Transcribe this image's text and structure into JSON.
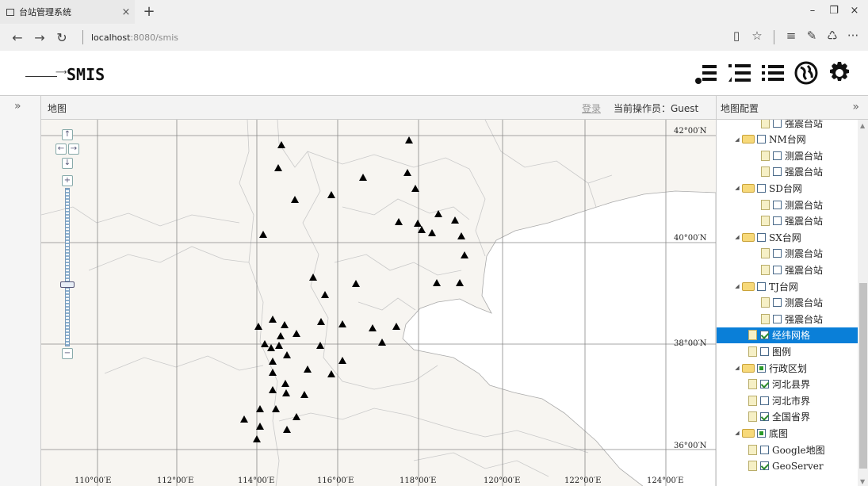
{
  "browser": {
    "tab_title": "台站管理系统",
    "tab_close": "×",
    "new_tab": "+",
    "minimize": "–",
    "restore": "❐",
    "close": "×",
    "back": "←",
    "forward": "→",
    "refresh": "↻",
    "url_host": "localhost",
    "url_path": ":8080/smis",
    "reading_view": "▯",
    "favorite": "☆",
    "hub": "≡",
    "notes": "✎",
    "share": "♺",
    "more": "···"
  },
  "app": {
    "logo_text": "SMIS",
    "toolbar_icons": [
      "layer-list-icon",
      "ordered-list-icon",
      "list-icon",
      "globe-icon",
      "gear-icon"
    ]
  },
  "left_panel": {
    "expand": "»"
  },
  "map_panel": {
    "title": "地图",
    "login_link": "登录",
    "operator_label": "当前操作员：Guest"
  },
  "map": {
    "lat_labels": [
      "42°00′N",
      "40°00′N",
      "38°00′N",
      "36°00′N"
    ],
    "lon_labels": [
      "110°00′E",
      "112°00′E",
      "114°00′E",
      "116°00′E",
      "118°00′E",
      "120°00′E",
      "122°00′E",
      "124°00′E"
    ],
    "zoom_controls": {
      "pan_up": "↑",
      "pan_left": "←",
      "pan_right": "→",
      "pan_down": "↓",
      "zoom_in": "+",
      "zoom_out": "−"
    }
  },
  "config_panel": {
    "title": "地图配置",
    "collapse": "»",
    "tree": [
      {
        "label": "强震台站",
        "level": 2,
        "type": "file",
        "checked": "off"
      },
      {
        "label": "NM台网",
        "level": 1,
        "type": "folder",
        "checked": "off"
      },
      {
        "label": "测震台站",
        "level": 2,
        "type": "file",
        "checked": "off"
      },
      {
        "label": "强震台站",
        "level": 2,
        "type": "file",
        "checked": "off"
      },
      {
        "label": "SD台网",
        "level": 1,
        "type": "folder",
        "checked": "off"
      },
      {
        "label": "测震台站",
        "level": 2,
        "type": "file",
        "checked": "off"
      },
      {
        "label": "强震台站",
        "level": 2,
        "type": "file",
        "checked": "off"
      },
      {
        "label": "SX台网",
        "level": 1,
        "type": "folder",
        "checked": "off"
      },
      {
        "label": "测震台站",
        "level": 2,
        "type": "file",
        "checked": "off"
      },
      {
        "label": "强震台站",
        "level": 2,
        "type": "file",
        "checked": "off"
      },
      {
        "label": "TJ台网",
        "level": 1,
        "type": "folder",
        "checked": "off"
      },
      {
        "label": "测震台站",
        "level": 2,
        "type": "file",
        "checked": "off"
      },
      {
        "label": "强震台站",
        "level": 2,
        "type": "file",
        "checked": "off"
      },
      {
        "label": "经纬网格",
        "level": 0,
        "type": "file",
        "checked": "on",
        "selected": true
      },
      {
        "label": "图例",
        "level": 0,
        "type": "file",
        "checked": "off"
      },
      {
        "label": "行政区划",
        "level": 0,
        "type": "folder",
        "checked": "part"
      },
      {
        "label": "河北县界",
        "level": 1,
        "type": "file",
        "checked": "on"
      },
      {
        "label": "河北市界",
        "level": 1,
        "type": "file",
        "checked": "off"
      },
      {
        "label": "全国省界",
        "level": 1,
        "type": "file",
        "checked": "on"
      },
      {
        "label": "底图",
        "level": 0,
        "type": "folder",
        "checked": "part"
      },
      {
        "label": "Google地图",
        "level": 1,
        "type": "file",
        "checked": "off"
      },
      {
        "label": "GeoServer",
        "level": 1,
        "type": "file",
        "checked": "on"
      }
    ]
  }
}
